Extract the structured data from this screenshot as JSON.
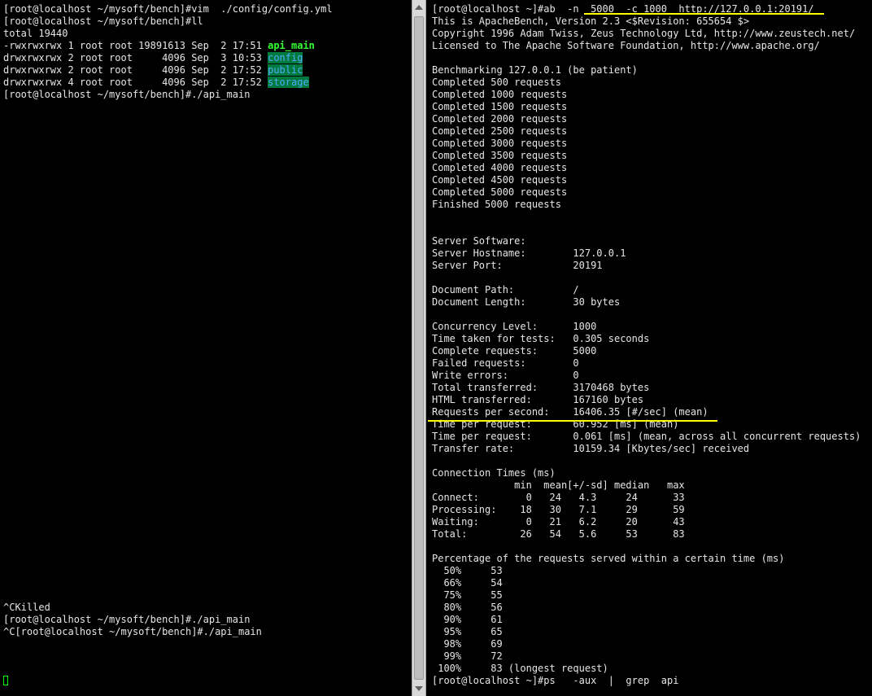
{
  "left": {
    "top_lines": [
      "[root@localhost ~/mysoft/bench]#vim  ./config/config.yml",
      "[root@localhost ~/mysoft/bench]#ll",
      "total 19440"
    ],
    "listing": [
      {
        "perms": "-rwxrwxrwx 1 root root 19891613 Sep  2 17:51 ",
        "name": "api_main"
      },
      {
        "perms": "drwxrwxrwx 2 root root     4096 Sep  3 10:53 ",
        "name": "config"
      },
      {
        "perms": "drwxrwxrwx 2 root root     4096 Sep  2 17:52 ",
        "name": "public"
      },
      {
        "perms": "drwxrwxrwx 4 root root     4096 Sep  2 17:52 ",
        "name": "storage"
      }
    ],
    "run_line": "[root@localhost ~/mysoft/bench]#./api_main",
    "bottom_lines": [
      "^CKilled",
      "[root@localhost ~/mysoft/bench]#./api_main",
      "^C[root@localhost ~/mysoft/bench]#./api_main"
    ]
  },
  "right": {
    "lines": [
      "[root@localhost ~]#ab  -n  5000  -c 1000  http://127.0.0.1:20191/",
      "This is ApacheBench, Version 2.3 <$Revision: 655654 $>",
      "Copyright 1996 Adam Twiss, Zeus Technology Ltd, http://www.zeustech.net/",
      "Licensed to The Apache Software Foundation, http://www.apache.org/",
      "",
      "Benchmarking 127.0.0.1 (be patient)",
      "Completed 500 requests",
      "Completed 1000 requests",
      "Completed 1500 requests",
      "Completed 2000 requests",
      "Completed 2500 requests",
      "Completed 3000 requests",
      "Completed 3500 requests",
      "Completed 4000 requests",
      "Completed 4500 requests",
      "Completed 5000 requests",
      "Finished 5000 requests",
      "",
      "",
      "Server Software:",
      "Server Hostname:        127.0.0.1",
      "Server Port:            20191",
      "",
      "Document Path:          /",
      "Document Length:        30 bytes",
      "",
      "Concurrency Level:      1000",
      "Time taken for tests:   0.305 seconds",
      "Complete requests:      5000",
      "Failed requests:        0",
      "Write errors:           0",
      "Total transferred:      3170468 bytes",
      "HTML transferred:       167160 bytes",
      "Requests per second:    16406.35 [#/sec] (mean)",
      "Time per request:       60.952 [ms] (mean)",
      "Time per request:       0.061 [ms] (mean, across all concurrent requests)",
      "Transfer rate:          10159.34 [Kbytes/sec] received",
      "",
      "Connection Times (ms)",
      "              min  mean[+/-sd] median   max",
      "Connect:        0   24   4.3     24      33",
      "Processing:    18   30   7.1     29      59",
      "Waiting:        0   21   6.2     20      43",
      "Total:         26   54   5.6     53      83",
      "",
      "Percentage of the requests served within a certain time (ms)",
      "  50%     53",
      "  66%     54",
      "  75%     55",
      "  80%     56",
      "  90%     61",
      "  95%     65",
      "  98%     69",
      "  99%     72",
      " 100%     83 (longest request)",
      "[root@localhost ~]#ps   -aux  |  grep  api"
    ]
  },
  "colors": {
    "background": "#000000",
    "text": "#e6e6e6",
    "executable": "#33ff33",
    "dir_bg": "#007a3d",
    "dir_fg": "#55a8ff",
    "annotation": "#ffff00",
    "cursor": "#00ff00"
  }
}
